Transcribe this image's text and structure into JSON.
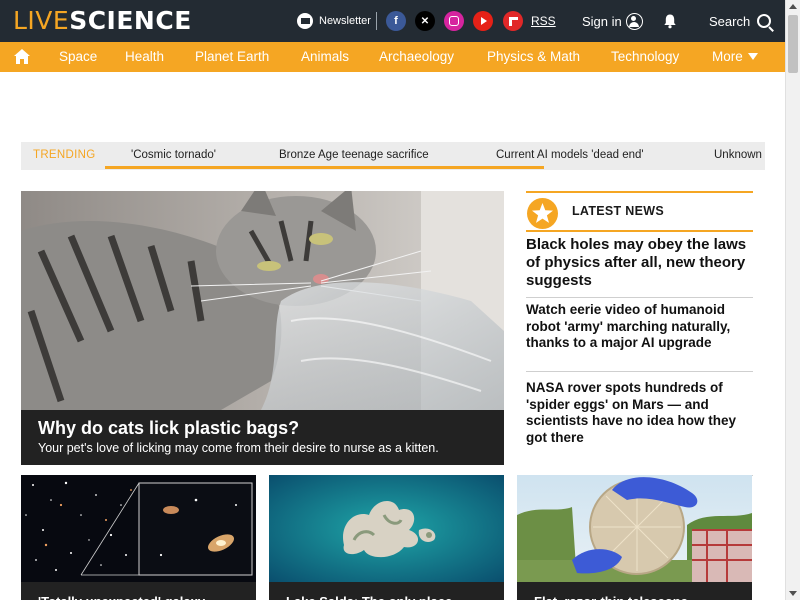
{
  "header": {
    "logo_live": "LIVE",
    "logo_science": "SCIENCE",
    "newsletter_label": "Newsletter",
    "social": [
      {
        "name": "facebook",
        "glyph": "f",
        "color": "#3b5998"
      },
      {
        "name": "x",
        "glyph": "𝕏",
        "color": "#000000"
      },
      {
        "name": "instagram",
        "glyph": "◎",
        "color": "#d6249f"
      },
      {
        "name": "youtube",
        "glyph": "▶",
        "color": "#e62117"
      },
      {
        "name": "flipboard",
        "glyph": "F",
        "color": "#e12828"
      }
    ],
    "rss_label": "RSS",
    "signin_label": "Sign in",
    "search_label": "Search"
  },
  "nav": {
    "home_icon": "home-icon",
    "items": [
      "Space",
      "Health",
      "Planet Earth",
      "Animals",
      "Archaeology",
      "Physics & Math",
      "Technology"
    ],
    "more_label": "More"
  },
  "trending": {
    "label": "TRENDING",
    "items": [
      "'Cosmic tornado'",
      "Bronze Age teenage sacrifice",
      "Current AI models 'dead end'",
      "Unknown"
    ]
  },
  "hero": {
    "title": "Why do cats lick plastic bags?",
    "subtitle": "Your pet's love of licking may come from their desire to nurse as a kitten."
  },
  "latest": {
    "heading": "LATEST NEWS",
    "items": [
      "Black holes may obey the laws of physics after all, new theory suggests",
      "Watch eerie video of humanoid robot 'army' marching naturally, thanks to a major AI upgrade",
      "NASA rover spots hundreds of 'spider eggs' on Mars — and scientists have no idea how they got there"
    ]
  },
  "cards": [
    {
      "title": "'Totally unexpected' galaxy"
    },
    {
      "title": "Lake Salda: The only place"
    },
    {
      "title": "Flat, razor-thin telescope"
    }
  ],
  "colors": {
    "accent": "#f5a623",
    "header_bg": "#232b33",
    "caption_bg": "#222222"
  }
}
